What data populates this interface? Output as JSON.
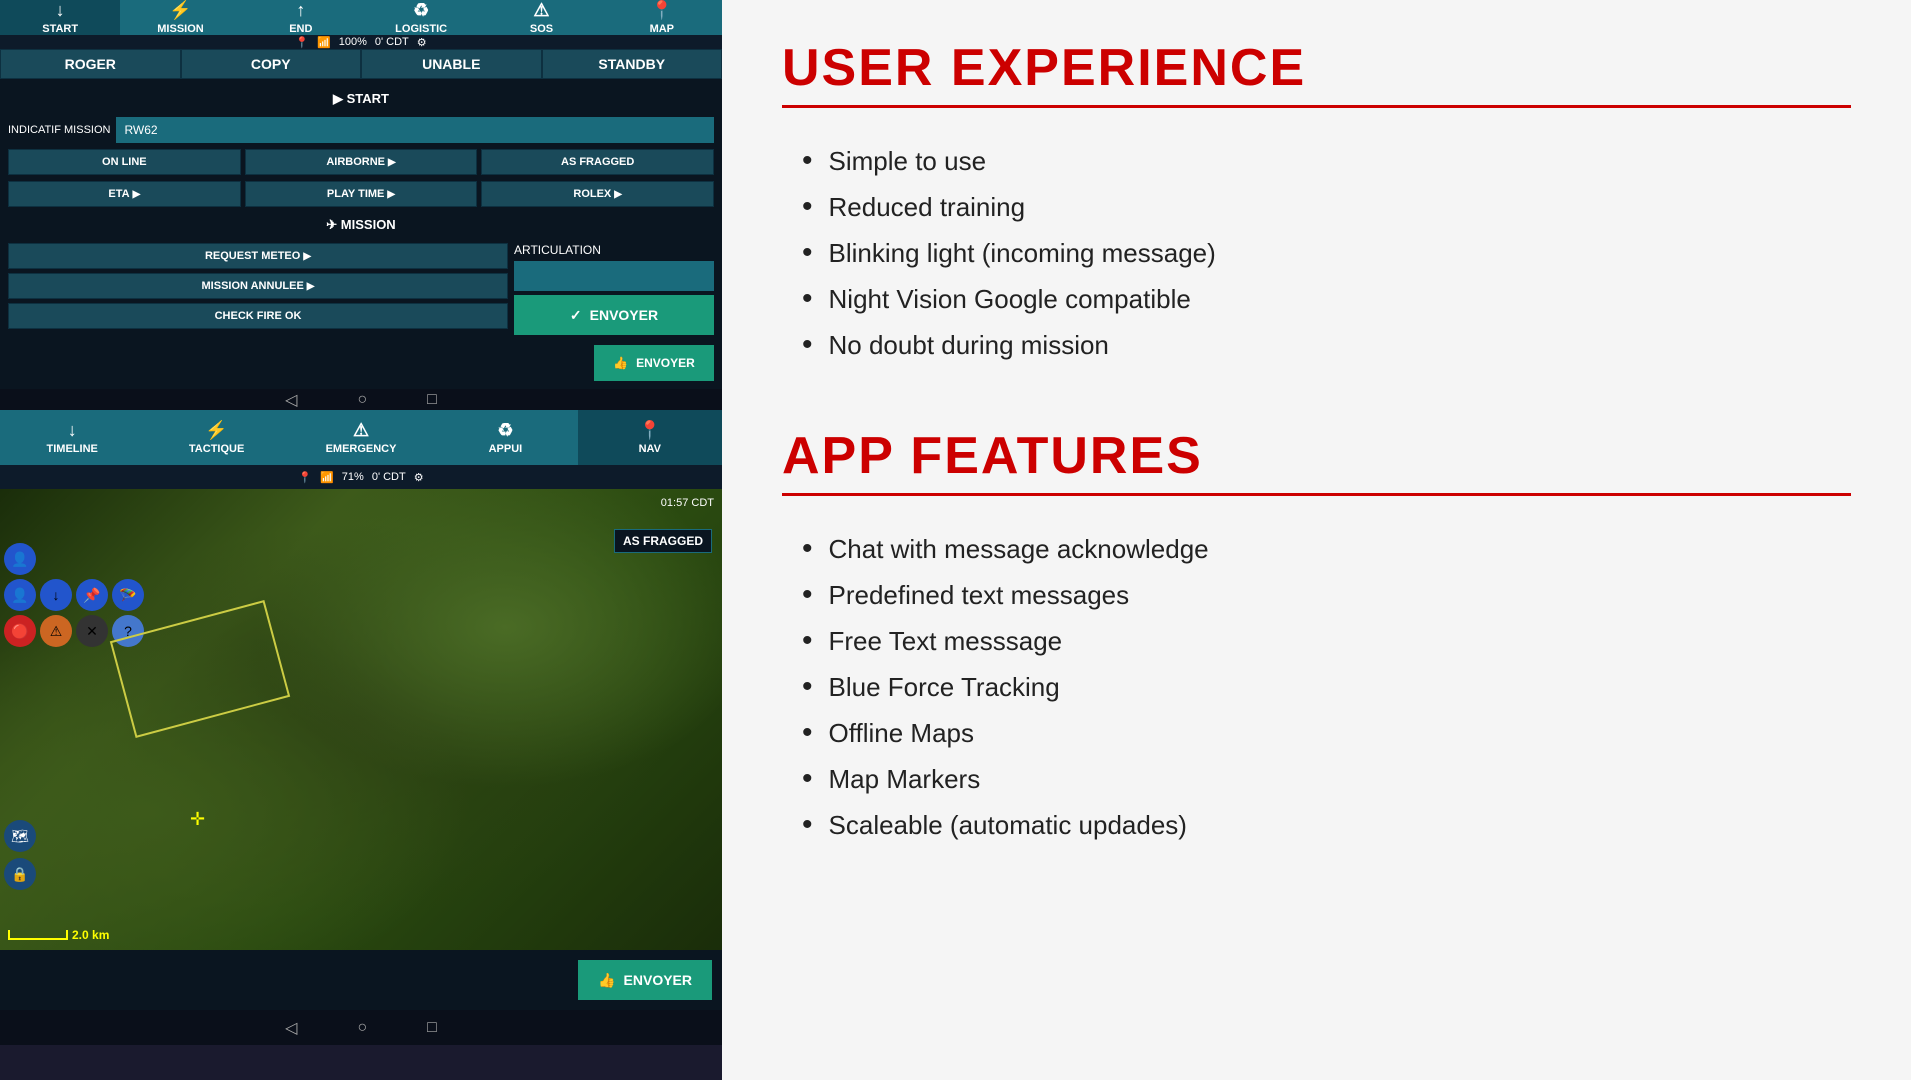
{
  "topApp": {
    "navItems": [
      {
        "id": "start",
        "icon": "↓",
        "label": "START",
        "active": true
      },
      {
        "id": "mission",
        "icon": "⚡",
        "label": "MISSION"
      },
      {
        "id": "end",
        "icon": "↑",
        "label": "END"
      },
      {
        "id": "logistic",
        "icon": "♻",
        "label": "LOGISTIC"
      },
      {
        "id": "sos",
        "icon": "⚠",
        "label": "SOS"
      },
      {
        "id": "map",
        "icon": "📍",
        "label": "MAP"
      }
    ],
    "statusBar": {
      "gps": "📍",
      "battery": "100%",
      "time": "0' CDT",
      "settings": "⚙"
    },
    "msgButtons": [
      {
        "label": "ROGER",
        "active": false
      },
      {
        "label": "COPY",
        "active": false
      },
      {
        "label": "UNABLE",
        "active": false
      },
      {
        "label": "STANDBY",
        "active": false
      }
    ],
    "startSection": {
      "title": "▶ START",
      "indicatifLabel": "INDICATIF MISSION",
      "indicatifValue": "RW62",
      "buttons": [
        {
          "label": "ON LINE",
          "hasArrow": false
        },
        {
          "label": "AIRBORNE",
          "hasArrow": true
        },
        {
          "label": "AS FRAGGED",
          "hasArrow": false
        }
      ],
      "buttons2": [
        {
          "label": "ETA",
          "hasArrow": true
        },
        {
          "label": "PLAY TIME",
          "hasArrow": true
        },
        {
          "label": "ROLEX",
          "hasArrow": true
        }
      ]
    },
    "missionSection": {
      "title": "✈ MISSION",
      "articulationLabel": "ARTICULATION",
      "leftButtons": [
        {
          "label": "REQUEST METEO",
          "hasArrow": true
        },
        {
          "label": "MISSION ANNULEE",
          "hasArrow": true
        },
        {
          "label": "CHECK FIRE OK",
          "hasArrow": false
        }
      ],
      "envoyerLabel": "ENVOYER",
      "envoyerIcon": "✓"
    },
    "androidNav": {
      "back": "◁",
      "home": "○",
      "square": "□"
    }
  },
  "bottomApp": {
    "navItems": [
      {
        "id": "timeline",
        "icon": "↓",
        "label": "TIMELINE"
      },
      {
        "id": "tactique",
        "icon": "⚡",
        "label": "TACTIQUE"
      },
      {
        "id": "emergency",
        "icon": "⚠",
        "label": "EMERGENCY"
      },
      {
        "id": "appui",
        "icon": "♻",
        "label": "APPUI"
      },
      {
        "id": "nav",
        "icon": "📍",
        "label": "NAV",
        "active": true
      }
    ],
    "statusBar": {
      "gps": "📍",
      "battery": "71%",
      "time": "0' CDT"
    },
    "map": {
      "timestamp": "01:57  CDT",
      "badge": "AS FRAGGED",
      "scaleText": "2.0 km"
    },
    "envoyerLabel": "ENVOYER",
    "envoyerIcon": "👍",
    "androidNav": {
      "back": "◁",
      "home": "○",
      "square": "□"
    }
  },
  "rightPanel": {
    "section1": {
      "title": "USER EXPERIENCE",
      "bullets": [
        "Simple to use",
        "Reduced training",
        "Blinking light (incoming message)",
        "Night Vision Google compatible",
        "No doubt during mission"
      ]
    },
    "section2": {
      "title": "APP FEATURES",
      "bullets": [
        "Chat with message acknowledge",
        "Predefined text messages",
        "Free Text messsage",
        "Blue Force Tracking",
        "Offline Maps",
        "Map Markers",
        "Scaleable (automatic updades)"
      ]
    }
  }
}
